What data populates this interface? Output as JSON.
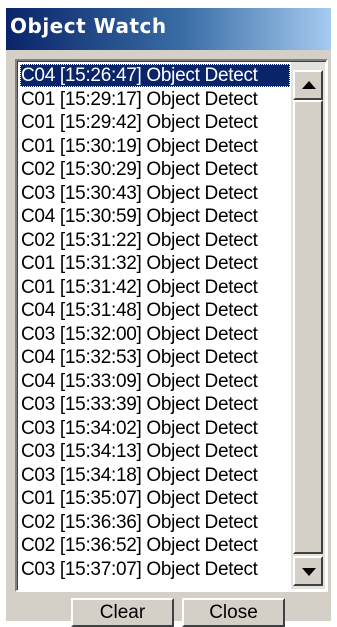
{
  "window": {
    "title": "Object Watch"
  },
  "list": {
    "items": [
      {
        "label": "C04 [15:26:47] Object Detect",
        "selected": true
      },
      {
        "label": "C01 [15:29:17] Object Detect",
        "selected": false
      },
      {
        "label": "C01 [15:29:42] Object Detect",
        "selected": false
      },
      {
        "label": "C01 [15:30:19] Object Detect",
        "selected": false
      },
      {
        "label": "C02 [15:30:29] Object Detect",
        "selected": false
      },
      {
        "label": "C03 [15:30:43] Object Detect",
        "selected": false
      },
      {
        "label": "C04 [15:30:59] Object Detect",
        "selected": false
      },
      {
        "label": "C02 [15:31:22] Object Detect",
        "selected": false
      },
      {
        "label": "C01 [15:31:32] Object Detect",
        "selected": false
      },
      {
        "label": "C01 [15:31:42] Object Detect",
        "selected": false
      },
      {
        "label": "C04 [15:31:48] Object Detect",
        "selected": false
      },
      {
        "label": "C03 [15:32:00] Object Detect",
        "selected": false
      },
      {
        "label": "C04 [15:32:53] Object Detect",
        "selected": false
      },
      {
        "label": "C04 [15:33:09] Object Detect",
        "selected": false
      },
      {
        "label": "C03 [15:33:39] Object Detect",
        "selected": false
      },
      {
        "label": "C03 [15:34:02] Object Detect",
        "selected": false
      },
      {
        "label": "C03 [15:34:13] Object Detect",
        "selected": false
      },
      {
        "label": "C03 [15:34:18] Object Detect",
        "selected": false
      },
      {
        "label": "C01 [15:35:07] Object Detect",
        "selected": false
      },
      {
        "label": "C02 [15:36:36] Object Detect",
        "selected": false
      },
      {
        "label": "C02 [15:36:52] Object Detect",
        "selected": false
      },
      {
        "label": "C03 [15:37:07] Object Detect",
        "selected": false
      }
    ],
    "scrollbar": {
      "up_icon": "scroll-up-arrow-icon",
      "down_icon": "scroll-down-arrow-icon"
    }
  },
  "buttons": {
    "clear_label": "Clear",
    "close_label": "Close"
  },
  "colors": {
    "title_bar_start": "#0a246a",
    "title_bar_end": "#a6caf0",
    "selection": "#0a246a",
    "face": "#d4d0c8"
  }
}
